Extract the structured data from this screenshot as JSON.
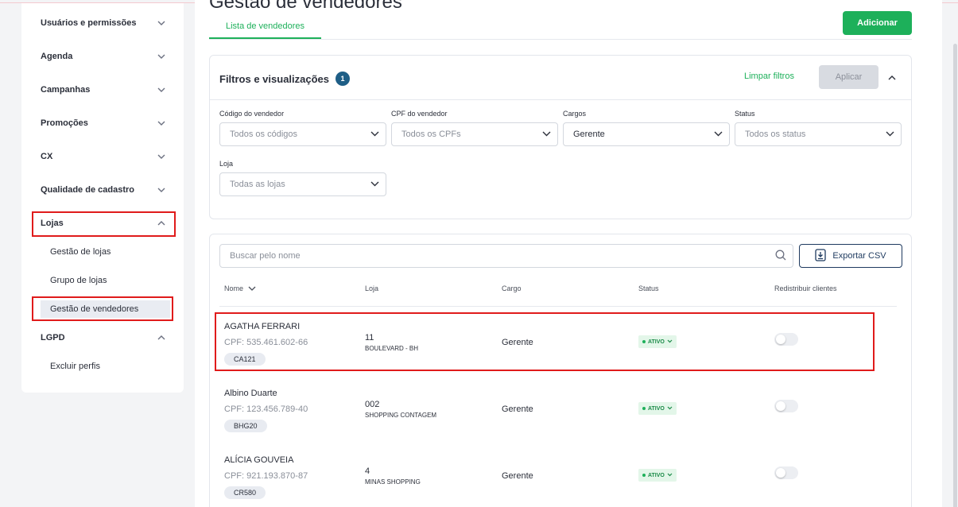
{
  "sidebar": {
    "items": [
      {
        "label": "Usuários e permissões",
        "chevron": "down"
      },
      {
        "label": "Agenda",
        "chevron": "down"
      },
      {
        "label": "Campanhas",
        "chevron": "down"
      },
      {
        "label": "Promoções",
        "chevron": "down"
      },
      {
        "label": "CX",
        "chevron": "down"
      },
      {
        "label": "Qualidade de cadastro",
        "chevron": "down"
      },
      {
        "label": "Lojas",
        "chevron": "up"
      },
      {
        "label": "LGPD",
        "chevron": "up"
      }
    ],
    "lojas_sub": [
      "Gestão de lojas",
      "Grupo de lojas",
      "Gestão de vendedores"
    ],
    "lgpd_sub": [
      "Excluir perfis"
    ]
  },
  "page": {
    "title": "Gestão de vendedores",
    "tab": "Lista de vendedores",
    "add_button": "Adicionar"
  },
  "filters": {
    "title": "Filtros e visualizações",
    "badge": "1",
    "clear": "Limpar filtros",
    "apply": "Aplicar",
    "fields": [
      {
        "label": "Código do vendedor",
        "value": "Todos os códigos"
      },
      {
        "label": "CPF do vendedor",
        "value": "Todos os CPFs"
      },
      {
        "label": "Cargos",
        "value": "Gerente"
      },
      {
        "label": "Status",
        "value": "Todos os status"
      },
      {
        "label": "Loja",
        "value": "Todas as lojas"
      }
    ]
  },
  "list": {
    "search_placeholder": "Buscar pelo nome",
    "export": "Exportar CSV",
    "columns": [
      "Nome",
      "Loja",
      "Cargo",
      "Status",
      "Redistribuir clientes"
    ],
    "rows": [
      {
        "name": "AGATHA FERRARI",
        "cpf": "CPF: 535.461.602-66",
        "code": "CA121",
        "loja_num": "11",
        "loja_name": "BOULEVARD - BH",
        "cargo": "Gerente",
        "status": "ATIVO"
      },
      {
        "name": "Albino Duarte",
        "cpf": "CPF: 123.456.789-40",
        "code": "BHG20",
        "loja_num": "002",
        "loja_name": "SHOPPING CONTAGEM",
        "cargo": "Gerente",
        "status": "ATIVO"
      },
      {
        "name": "ALÍCIA GOUVEIA",
        "cpf": "CPF: 921.193.870-87",
        "code": "CR580",
        "loja_num": "4",
        "loja_name": "MINAS SHOPPING",
        "cargo": "Gerente",
        "status": "ATIVO"
      }
    ]
  },
  "colors": {
    "accent": "#1db05a",
    "highlight": "#e01b1b",
    "badge": "#1e5e86"
  }
}
